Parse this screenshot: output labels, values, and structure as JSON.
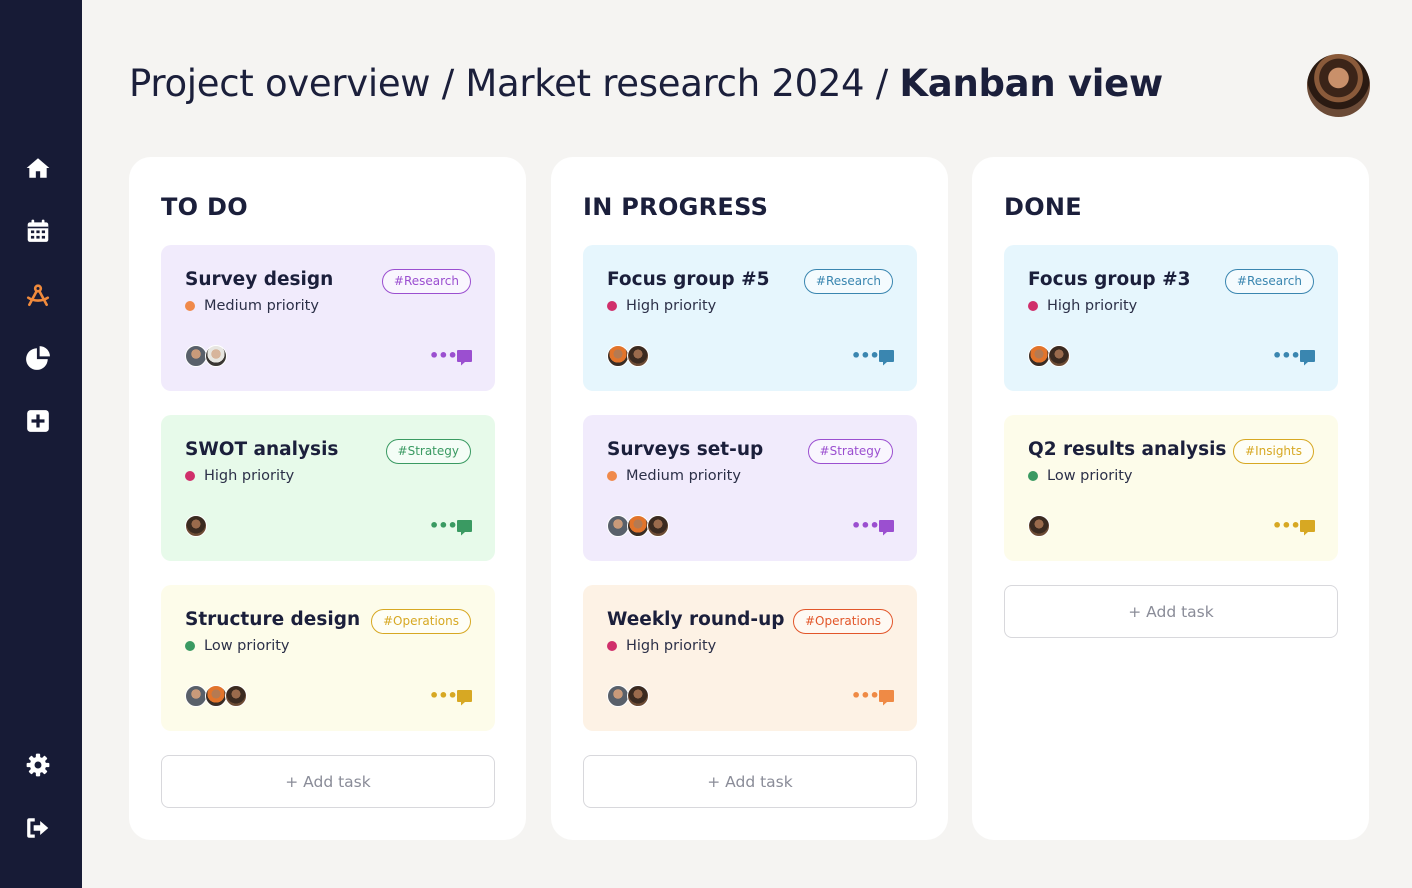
{
  "breadcrumb": {
    "part1": "Project overview",
    "separator": " / ",
    "part2": "Market research 2024",
    "current": "Kanban view"
  },
  "sidebar": {
    "items": [
      {
        "icon": "home-icon"
      },
      {
        "icon": "calendar-icon"
      },
      {
        "icon": "tools-icon",
        "active": true
      },
      {
        "icon": "pie-chart-icon"
      },
      {
        "icon": "add-square-icon"
      },
      {
        "icon": "gear-icon"
      },
      {
        "icon": "logout-icon"
      }
    ]
  },
  "colors": {
    "sidebar_bg": "#171b36",
    "sidebar_icon": "#ffffff",
    "sidebar_active": "#f08a3c",
    "page_bg": "#f5f4f2",
    "priority_high": "#d02f6b",
    "priority_medium": "#f0894a",
    "priority_low": "#3a9a62"
  },
  "add_task_label": "+ Add task",
  "columns": [
    {
      "title": "TO DO",
      "cards": [
        {
          "title": "Survey design",
          "tag": "#Research",
          "priority": "Medium priority",
          "priority_level": "medium",
          "theme": "purple",
          "assignees": 2
        },
        {
          "title": "SWOT analysis",
          "tag": "#Strategy",
          "priority": "High priority",
          "priority_level": "high",
          "theme": "green",
          "assignees": 1
        },
        {
          "title": "Structure design",
          "tag": "#Operations",
          "priority": "Low priority",
          "priority_level": "low",
          "theme": "yellow",
          "assignees": 3
        }
      ]
    },
    {
      "title": "IN PROGRESS",
      "cards": [
        {
          "title": "Focus group #5",
          "tag": "#Research",
          "priority": "High priority",
          "priority_level": "high",
          "theme": "blue",
          "assignees": 2
        },
        {
          "title": "Surveys set-up",
          "tag": "#Strategy",
          "priority": "Medium priority",
          "priority_level": "medium",
          "theme": "purple",
          "assignees": 3
        },
        {
          "title": "Weekly round-up",
          "tag": "#Operations",
          "priority": "High priority",
          "priority_level": "high",
          "theme": "orange",
          "assignees": 2
        }
      ]
    },
    {
      "title": "DONE",
      "cards": [
        {
          "title": "Focus group #3",
          "tag": "#Research",
          "priority": "High priority",
          "priority_level": "high",
          "theme": "blue",
          "assignees": 2
        },
        {
          "title": "Q2 results analysis",
          "tag": "#Insights",
          "priority": "Low priority",
          "priority_level": "low",
          "theme": "yellow",
          "assignees": 1
        }
      ]
    }
  ]
}
